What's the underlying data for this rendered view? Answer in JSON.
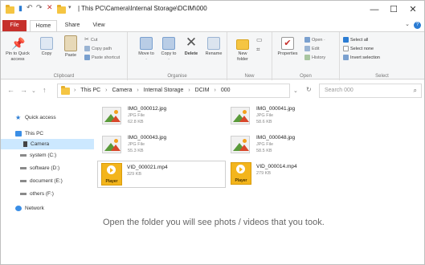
{
  "window": {
    "title": "| This PC\\Camera\\Internal Storage\\DCIM\\000",
    "minimize": "—",
    "maximize": "☐",
    "close": "✕"
  },
  "tabs": [
    "File",
    "Home",
    "Share",
    "View"
  ],
  "ribbon": {
    "clipboard": {
      "label": "Clipboard",
      "pin": "Pin to Quick access",
      "copy": "Copy",
      "paste": "Paste",
      "cut": "Cut",
      "copy_path": "Copy path",
      "paste_shortcut": "Paste shortcut"
    },
    "organise": {
      "label": "Organise",
      "move_to": "Move to ·",
      "copy_to": "Copy to ·",
      "delete": "Delete",
      "rename": "Rename"
    },
    "new": {
      "label": "New",
      "new_folder": "New folder"
    },
    "open": {
      "label": "Open",
      "properties": "Properties",
      "open": "Open ·",
      "edit": "Edit",
      "history": "History"
    },
    "select": {
      "label": "Select",
      "select_all": "Select all",
      "select_none": "Select none",
      "invert": "Invert selection"
    }
  },
  "address": {
    "path": [
      "This PC",
      "Camera",
      "Internal Storage",
      "DCIM",
      "000"
    ],
    "separator": "›",
    "search_placeholder": "Search 000"
  },
  "nav_pane": {
    "items": [
      {
        "label": "Quick access",
        "icon": "star-icon"
      },
      {
        "label": "This PC",
        "icon": "pc-icon"
      },
      {
        "label": "Camera",
        "icon": "camera-icon"
      },
      {
        "label": "system (C:)",
        "icon": "drive-icon"
      },
      {
        "label": "software (D:)",
        "icon": "drive-icon"
      },
      {
        "label": "document (E:)",
        "icon": "drive-icon"
      },
      {
        "label": "others (F:)",
        "icon": "drive-icon"
      },
      {
        "label": "Network",
        "icon": "network-icon"
      }
    ]
  },
  "files": [
    {
      "name": "IMG_000012.jpg",
      "type": "JPG File",
      "size": "62.8 KB",
      "kind": "image"
    },
    {
      "name": "IMG_000041.jpg",
      "type": "JPG File",
      "size": "58.6 KB",
      "kind": "image"
    },
    {
      "name": "IMG_000043.jpg",
      "type": "JPG File",
      "size": "55.3 KB",
      "kind": "image"
    },
    {
      "name": "IMG_000048.jpg",
      "type": "JPG File",
      "size": "58.5 KB",
      "kind": "image"
    },
    {
      "name": "VID_000021.mp4",
      "type": "",
      "size": "329 KB",
      "kind": "video",
      "badge": "Player"
    },
    {
      "name": "VID_000014.mp4",
      "type": "",
      "size": "279 KB",
      "kind": "video",
      "badge": "Player"
    }
  ],
  "caption": "Open the folder you will see phots / videos that you took."
}
